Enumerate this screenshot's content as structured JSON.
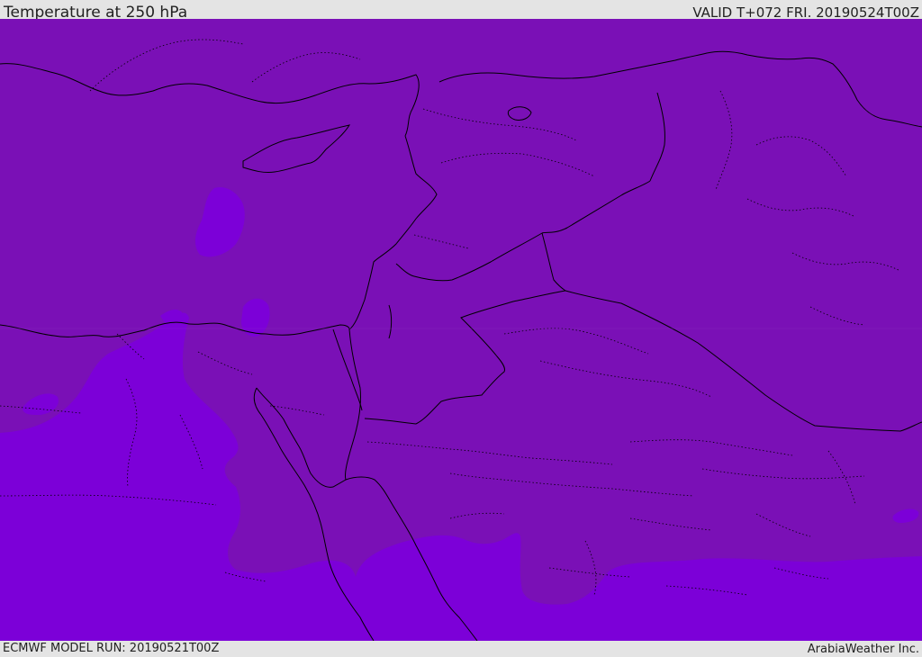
{
  "header": {
    "title": "Temperature at 250 hPa",
    "valid_time": "VALID T+072 FRI. 20190524T00Z"
  },
  "footer": {
    "model_run": "ECMWF MODEL RUN: 20190521T00Z",
    "credit": "ArabiaWeather Inc."
  },
  "colors": {
    "warmer_band": "#7a10b6",
    "colder_band": "#7c00d8",
    "coastline": "#000000",
    "border": "#000000",
    "frame": "#e4e4e4"
  }
}
